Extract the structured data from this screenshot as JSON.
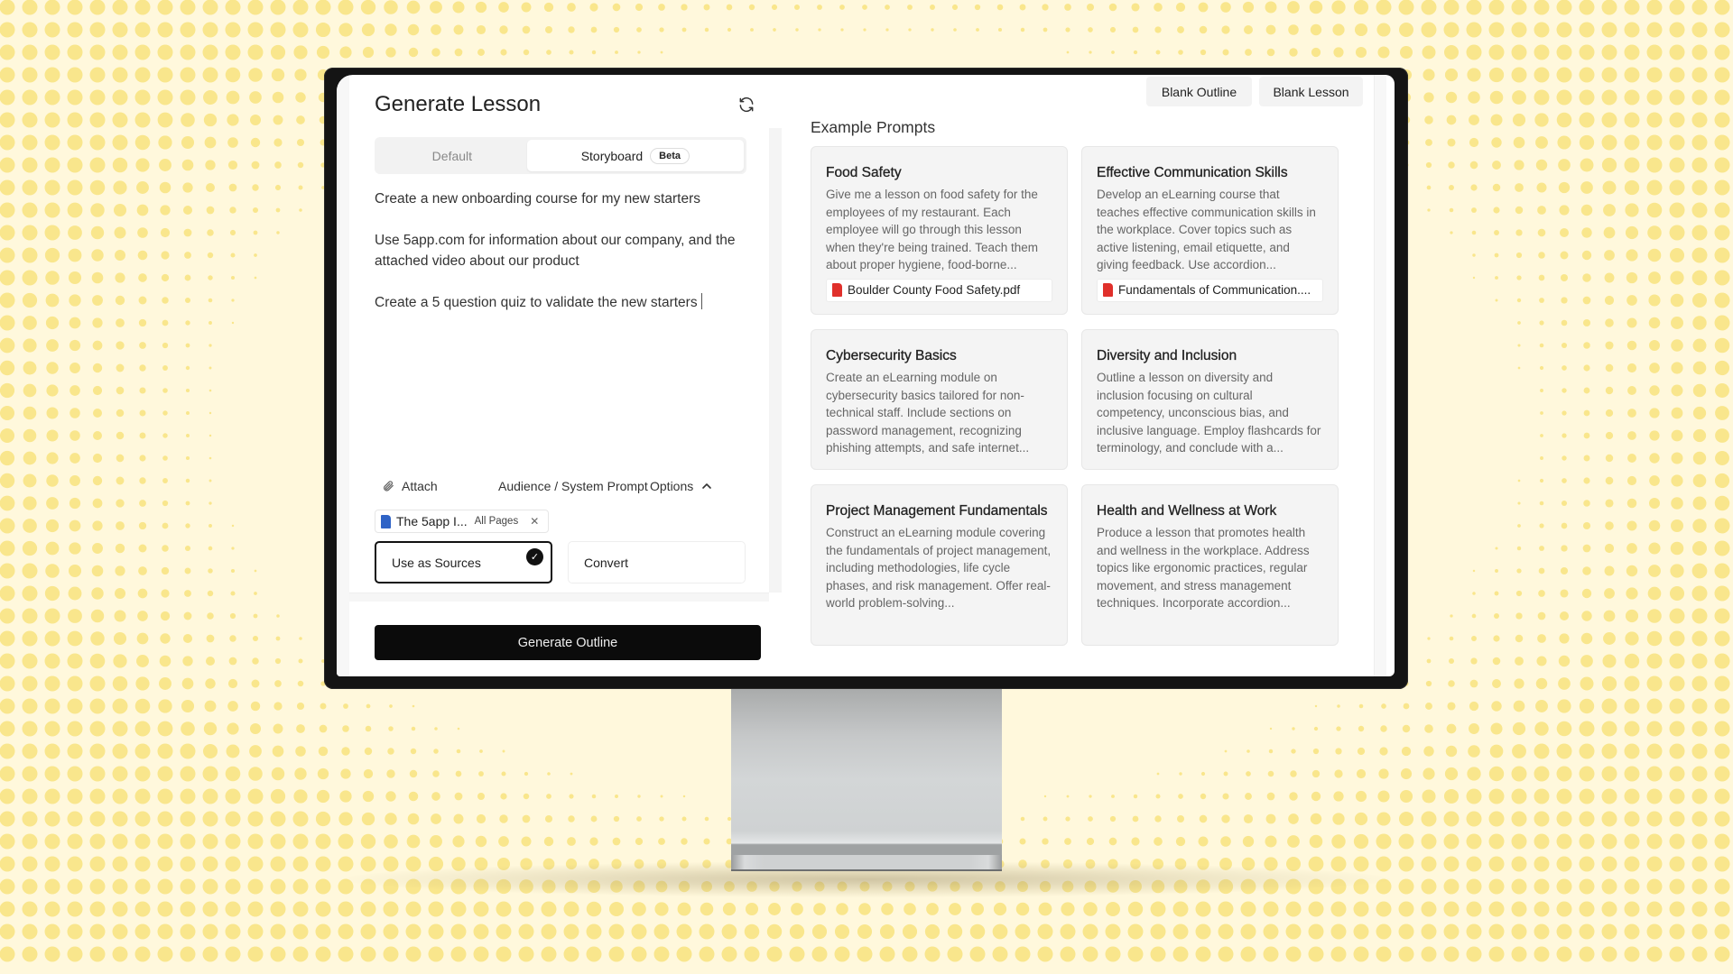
{
  "app": {
    "title": "Generate Lesson",
    "refresh_icon": "refresh-icon"
  },
  "mode_tabs": [
    {
      "label": "Default",
      "active": false
    },
    {
      "label": "Storyboard",
      "active": true,
      "badge": "Beta"
    }
  ],
  "prompt": {
    "lines": [
      "Create a new onboarding course for my new starters",
      "Use 5app.com for information about our company, and the attached video about our product",
      "Create a 5 question quiz to validate the new starters"
    ]
  },
  "actions": {
    "attach_label": "Attach",
    "attach_icon": "paperclip-icon",
    "audience_label": "Audience / System Prompt",
    "options_label": "Options",
    "options_icon": "chevron-up-icon"
  },
  "attachment": {
    "name": "The 5app I...",
    "pages": "All Pages",
    "icon": "document-icon",
    "remove_icon": "close-icon"
  },
  "source_options": [
    {
      "label": "Use as Sources",
      "selected": true
    },
    {
      "label": "Convert",
      "selected": false
    }
  ],
  "generate_button": "Generate Outline",
  "top_buttons": {
    "blank_outline": "Blank Outline",
    "blank_lesson": "Blank Lesson"
  },
  "examples": {
    "title": "Example Prompts",
    "cards": [
      {
        "title": "Food Safety",
        "description": "Give me a lesson on food safety for the employees of my restaurant. Each employee will go through this lesson when they're being trained. Teach them about proper hygiene, food-borne...",
        "file": "Boulder County Food Safety.pdf"
      },
      {
        "title": "Effective Communication Skills",
        "description": "Develop an eLearning course that teaches effective communication skills in the workplace. Cover topics such as active listening, email etiquette, and giving feedback. Use accordion...",
        "file": "Fundamentals of Communication...."
      },
      {
        "title": "Cybersecurity Basics",
        "description": "Create an eLearning module on cybersecurity basics tailored for non-technical staff. Include sections on password management, recognizing phishing attempts, and safe internet..."
      },
      {
        "title": "Diversity and Inclusion",
        "description": "Outline a lesson on diversity and inclusion focusing on cultural competency, unconscious bias, and inclusive language. Employ flashcards for terminology, and conclude with a..."
      },
      {
        "title": "Project Management Fundamentals",
        "description": "Construct an eLearning module covering the fundamentals of project management, including methodologies, life cycle phases, and risk management. Offer real-world problem-solving..."
      },
      {
        "title": "Health and Wellness at Work",
        "description": "Produce a lesson that promotes health and wellness in the workplace. Address topics like ergonomic practices, regular movement, and stress management techniques. Incorporate accordion..."
      }
    ]
  },
  "colors": {
    "background": "#FFF8DC",
    "dots": "#F9E68C",
    "monitor_frame": "#141414",
    "primary_button": "#0B0B0B",
    "pdf_icon": "#E0302B",
    "doc_icon": "#2F63C6"
  }
}
